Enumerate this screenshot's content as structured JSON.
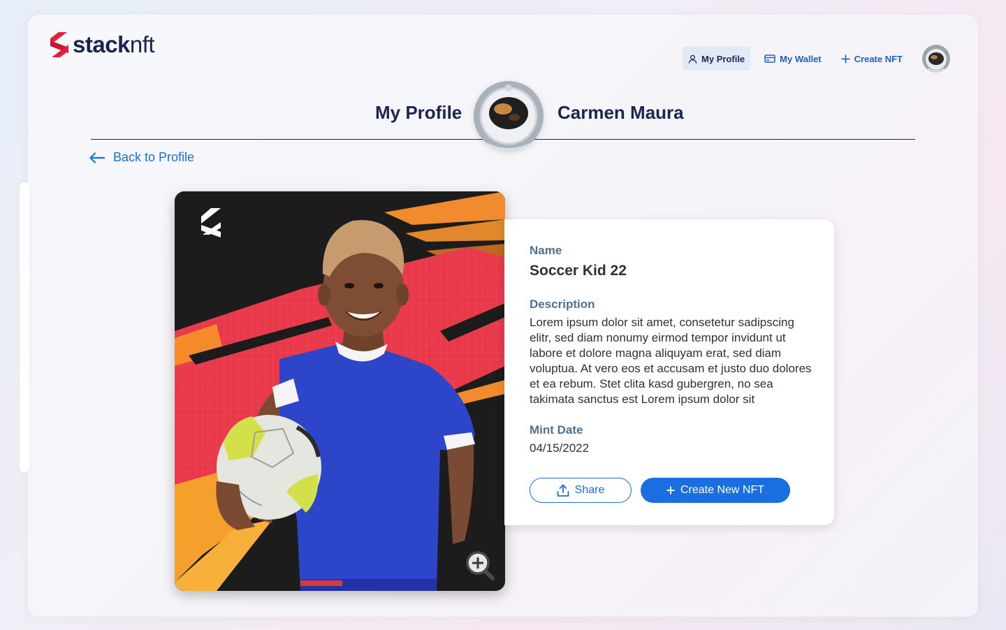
{
  "app": {
    "logo_bold": "stack",
    "logo_thin": "nft"
  },
  "nav": {
    "items": [
      {
        "label": "My Profile",
        "icon": "user-icon",
        "active": true
      },
      {
        "label": "My Wallet",
        "icon": "card-icon"
      },
      {
        "label": "Create NFT",
        "icon": "plus-icon"
      }
    ]
  },
  "profile": {
    "title": "My Profile",
    "name": "Carmen Maura"
  },
  "back_link": "Back to Profile",
  "nft": {
    "name_label": "Name",
    "name": "Soccer Kid 22",
    "description_label": "Description",
    "description": "Lorem ipsum dolor sit amet, consetetur sadipscing elitr, sed diam nonumy eirmod tempor invidunt ut labore et dolore magna aliquyam erat, sed diam voluptua. At vero eos et accusam et justo duo dolores et ea rebum. Stet clita kasd gubergren, no sea takimata sanctus est Lorem ipsum dolor sit",
    "mint_date_label": "Mint Date",
    "mint_date": "04/15/2022"
  },
  "actions": {
    "share": "Share",
    "create": "Create New NFT"
  },
  "colors": {
    "primary": "#1a6fe0",
    "navy": "#1c2550",
    "label": "#50708f",
    "brand_red": "#e41e3b"
  }
}
